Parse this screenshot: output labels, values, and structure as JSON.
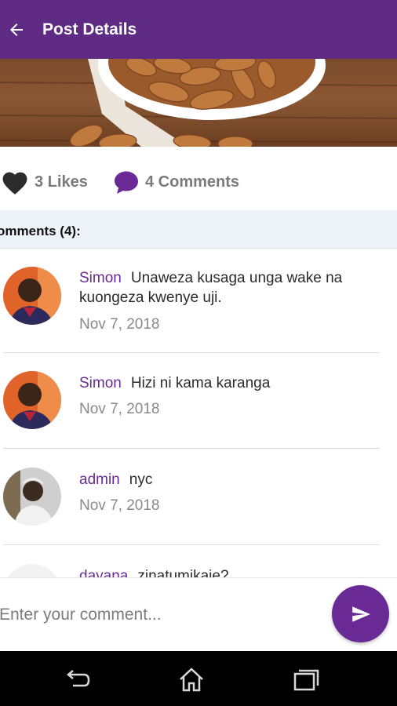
{
  "appbar": {
    "title": "Post Details"
  },
  "stats": {
    "likes_label": "3 Likes",
    "comments_label": "4 Comments"
  },
  "comments_header": "omments (4):",
  "comments": [
    {
      "author": "Simon",
      "text": "Unaweza kusaga unga wake na kuongeza kwenye uji.",
      "date": "Nov 7, 2018"
    },
    {
      "author": "Simon",
      "text": "Hizi ni kama karanga",
      "date": "Nov 7, 2018"
    },
    {
      "author": "admin",
      "text": "nyc",
      "date": "Nov 7, 2018"
    },
    {
      "author": "dayana",
      "text": "zinatumikaje?",
      "date": ""
    }
  ],
  "input": {
    "placeholder": "Enter your comment..."
  },
  "colors": {
    "primary": "#5e2a84",
    "accent": "#6a2a96"
  }
}
